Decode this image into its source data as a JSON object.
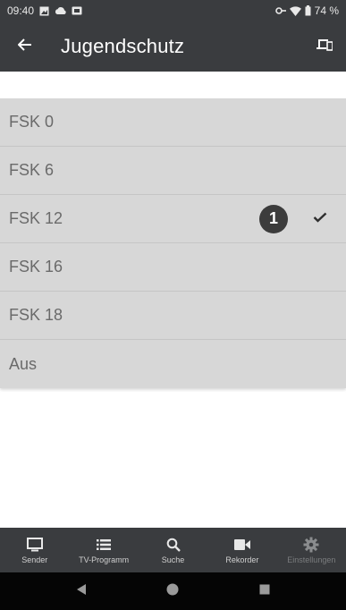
{
  "status_bar": {
    "time": "09:40",
    "battery": "74 %"
  },
  "app_bar": {
    "title": "Jugendschutz",
    "icons": [
      "back-arrow-icon",
      "cast-device-icon"
    ]
  },
  "options": {
    "items": [
      {
        "label": "FSK 0",
        "selected": false
      },
      {
        "label": "FSK 6",
        "selected": false
      },
      {
        "label": "FSK 12",
        "selected": true
      },
      {
        "label": "FSK 16",
        "selected": false
      },
      {
        "label": "FSK 18",
        "selected": false
      },
      {
        "label": "Aus",
        "selected": false
      }
    ],
    "annotation": "1"
  },
  "bottom_nav": {
    "items": [
      {
        "label": "Sender",
        "icon": "tv-icon"
      },
      {
        "label": "TV-Programm",
        "icon": "list-icon"
      },
      {
        "label": "Suche",
        "icon": "search-icon"
      },
      {
        "label": "Rekorder",
        "icon": "recorder-icon"
      },
      {
        "label": "Einstellungen",
        "icon": "gear-icon",
        "active": true
      }
    ]
  },
  "colors": {
    "app_bar": "#3a3c3f",
    "list_background": "#d7d7d7",
    "option_text": "#6a6a6a",
    "system_nav": "#050505"
  }
}
